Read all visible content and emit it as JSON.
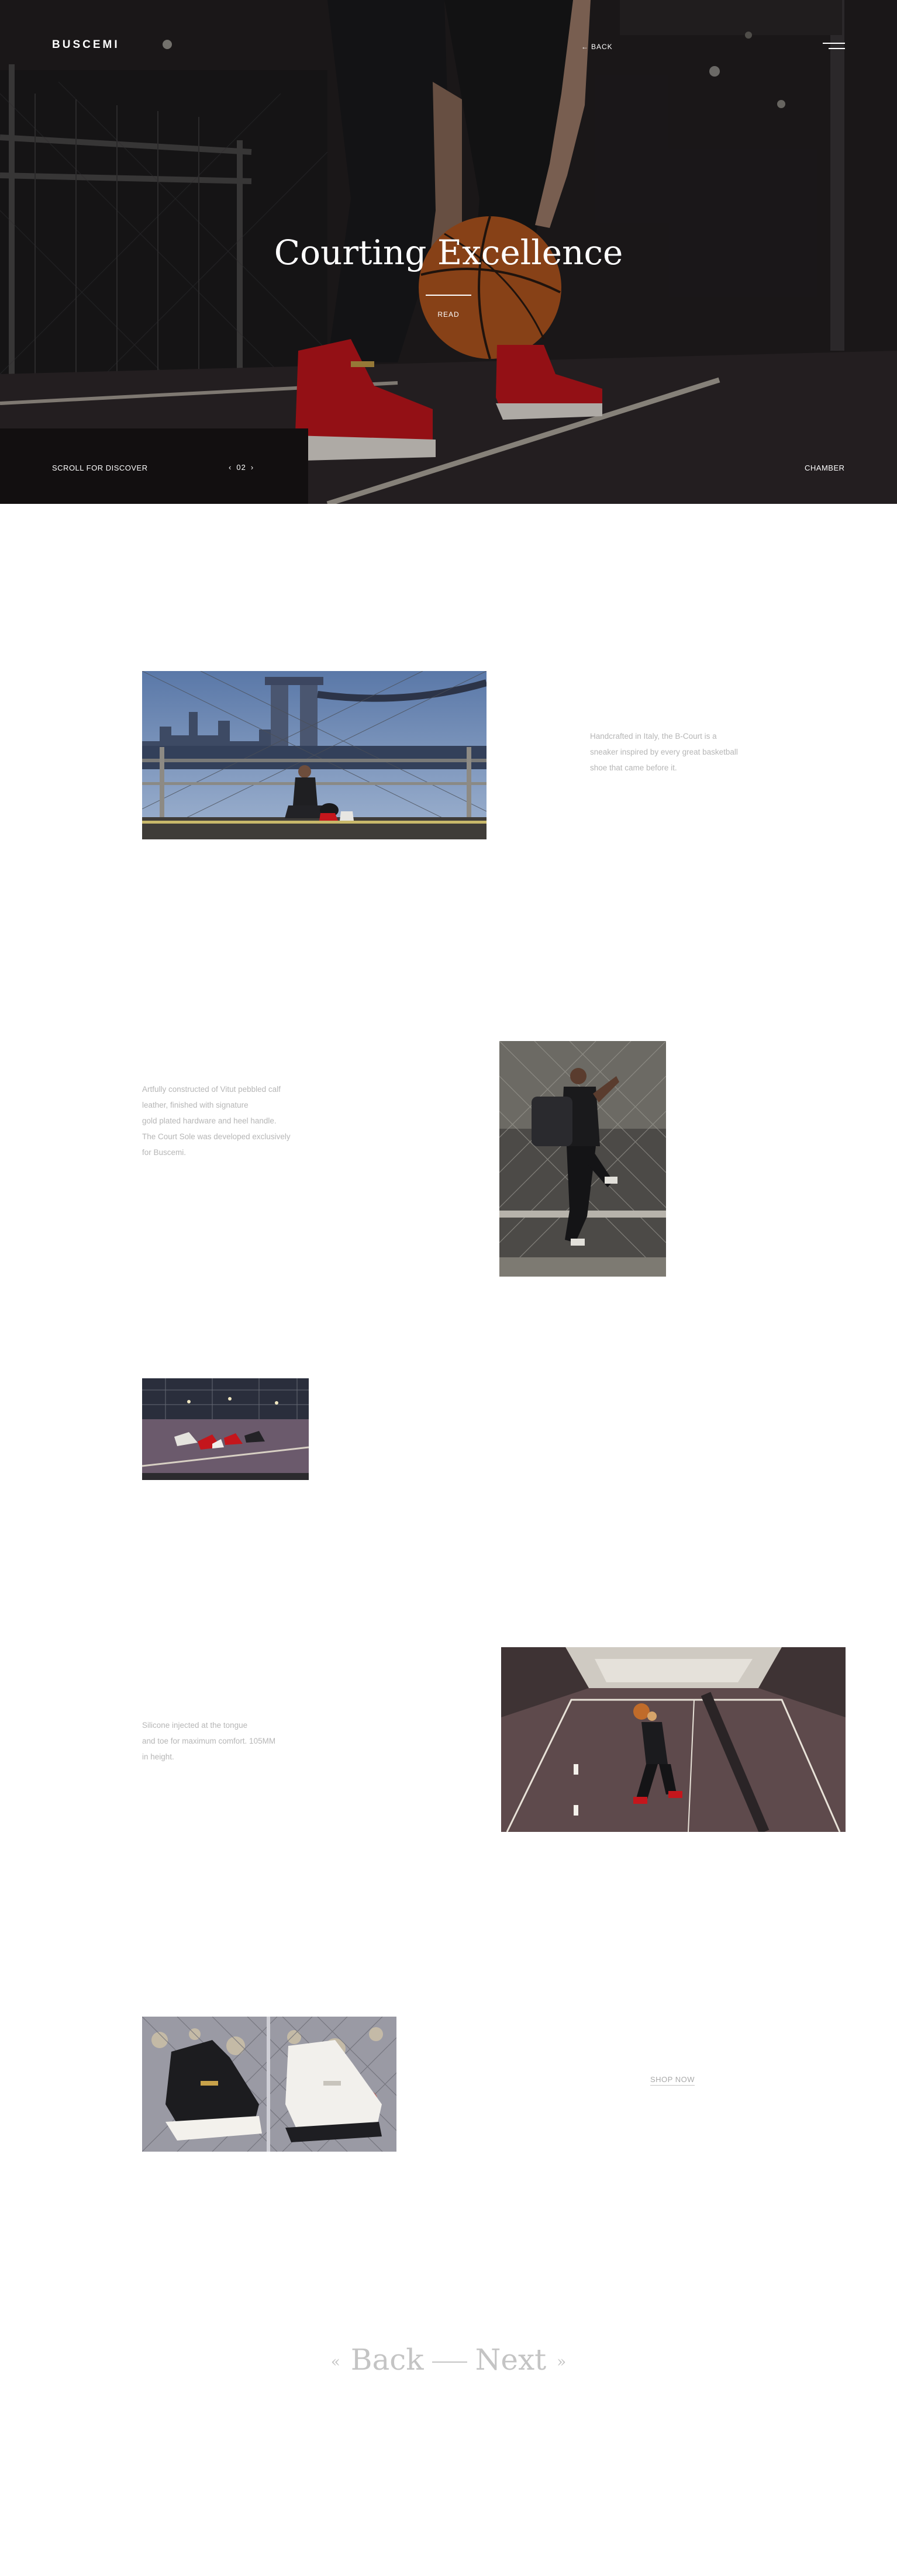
{
  "header": {
    "logo": "BUSCEMI",
    "back_label": "BACK",
    "back_arrow": "←",
    "menu_icon": "hamburger-icon"
  },
  "hero": {
    "title": "Courting Excellence",
    "read_label": "READ",
    "scroll_label": "SCROLL FOR DISCOVER",
    "pager_prev": "‹",
    "pager_number": "02",
    "pager_next": "›",
    "chamber_label": "CHAMBER",
    "colors": {
      "panel": "#120f10",
      "shoe_red": "#c4161c",
      "ball": "#b5571f"
    }
  },
  "sections": {
    "caption_1": [
      "Handcrafted in Italy, the B-Court is a",
      "sneaker inspired by every great basketball",
      "shoe that came before it."
    ],
    "caption_2": [
      "Artfully constructed of Vitut pebbled calf",
      "leather, finished with signature",
      "gold plated hardware and heel handle.",
      "The Court Sole was developed exclusively",
      "for Buscemi."
    ],
    "caption_3": [
      "Silicone injected at the tongue",
      "and toe for maximum comfort. 105MM",
      "in height."
    ],
    "shop_label": "SHOP NOW"
  },
  "footer_nav": {
    "prev_chevron": "«",
    "back_label": "Back",
    "next_label": "Next",
    "next_chevron": "»"
  },
  "colors": {
    "caption_text": "#b6b6b6",
    "footer_nav": "#c4c4c4"
  }
}
